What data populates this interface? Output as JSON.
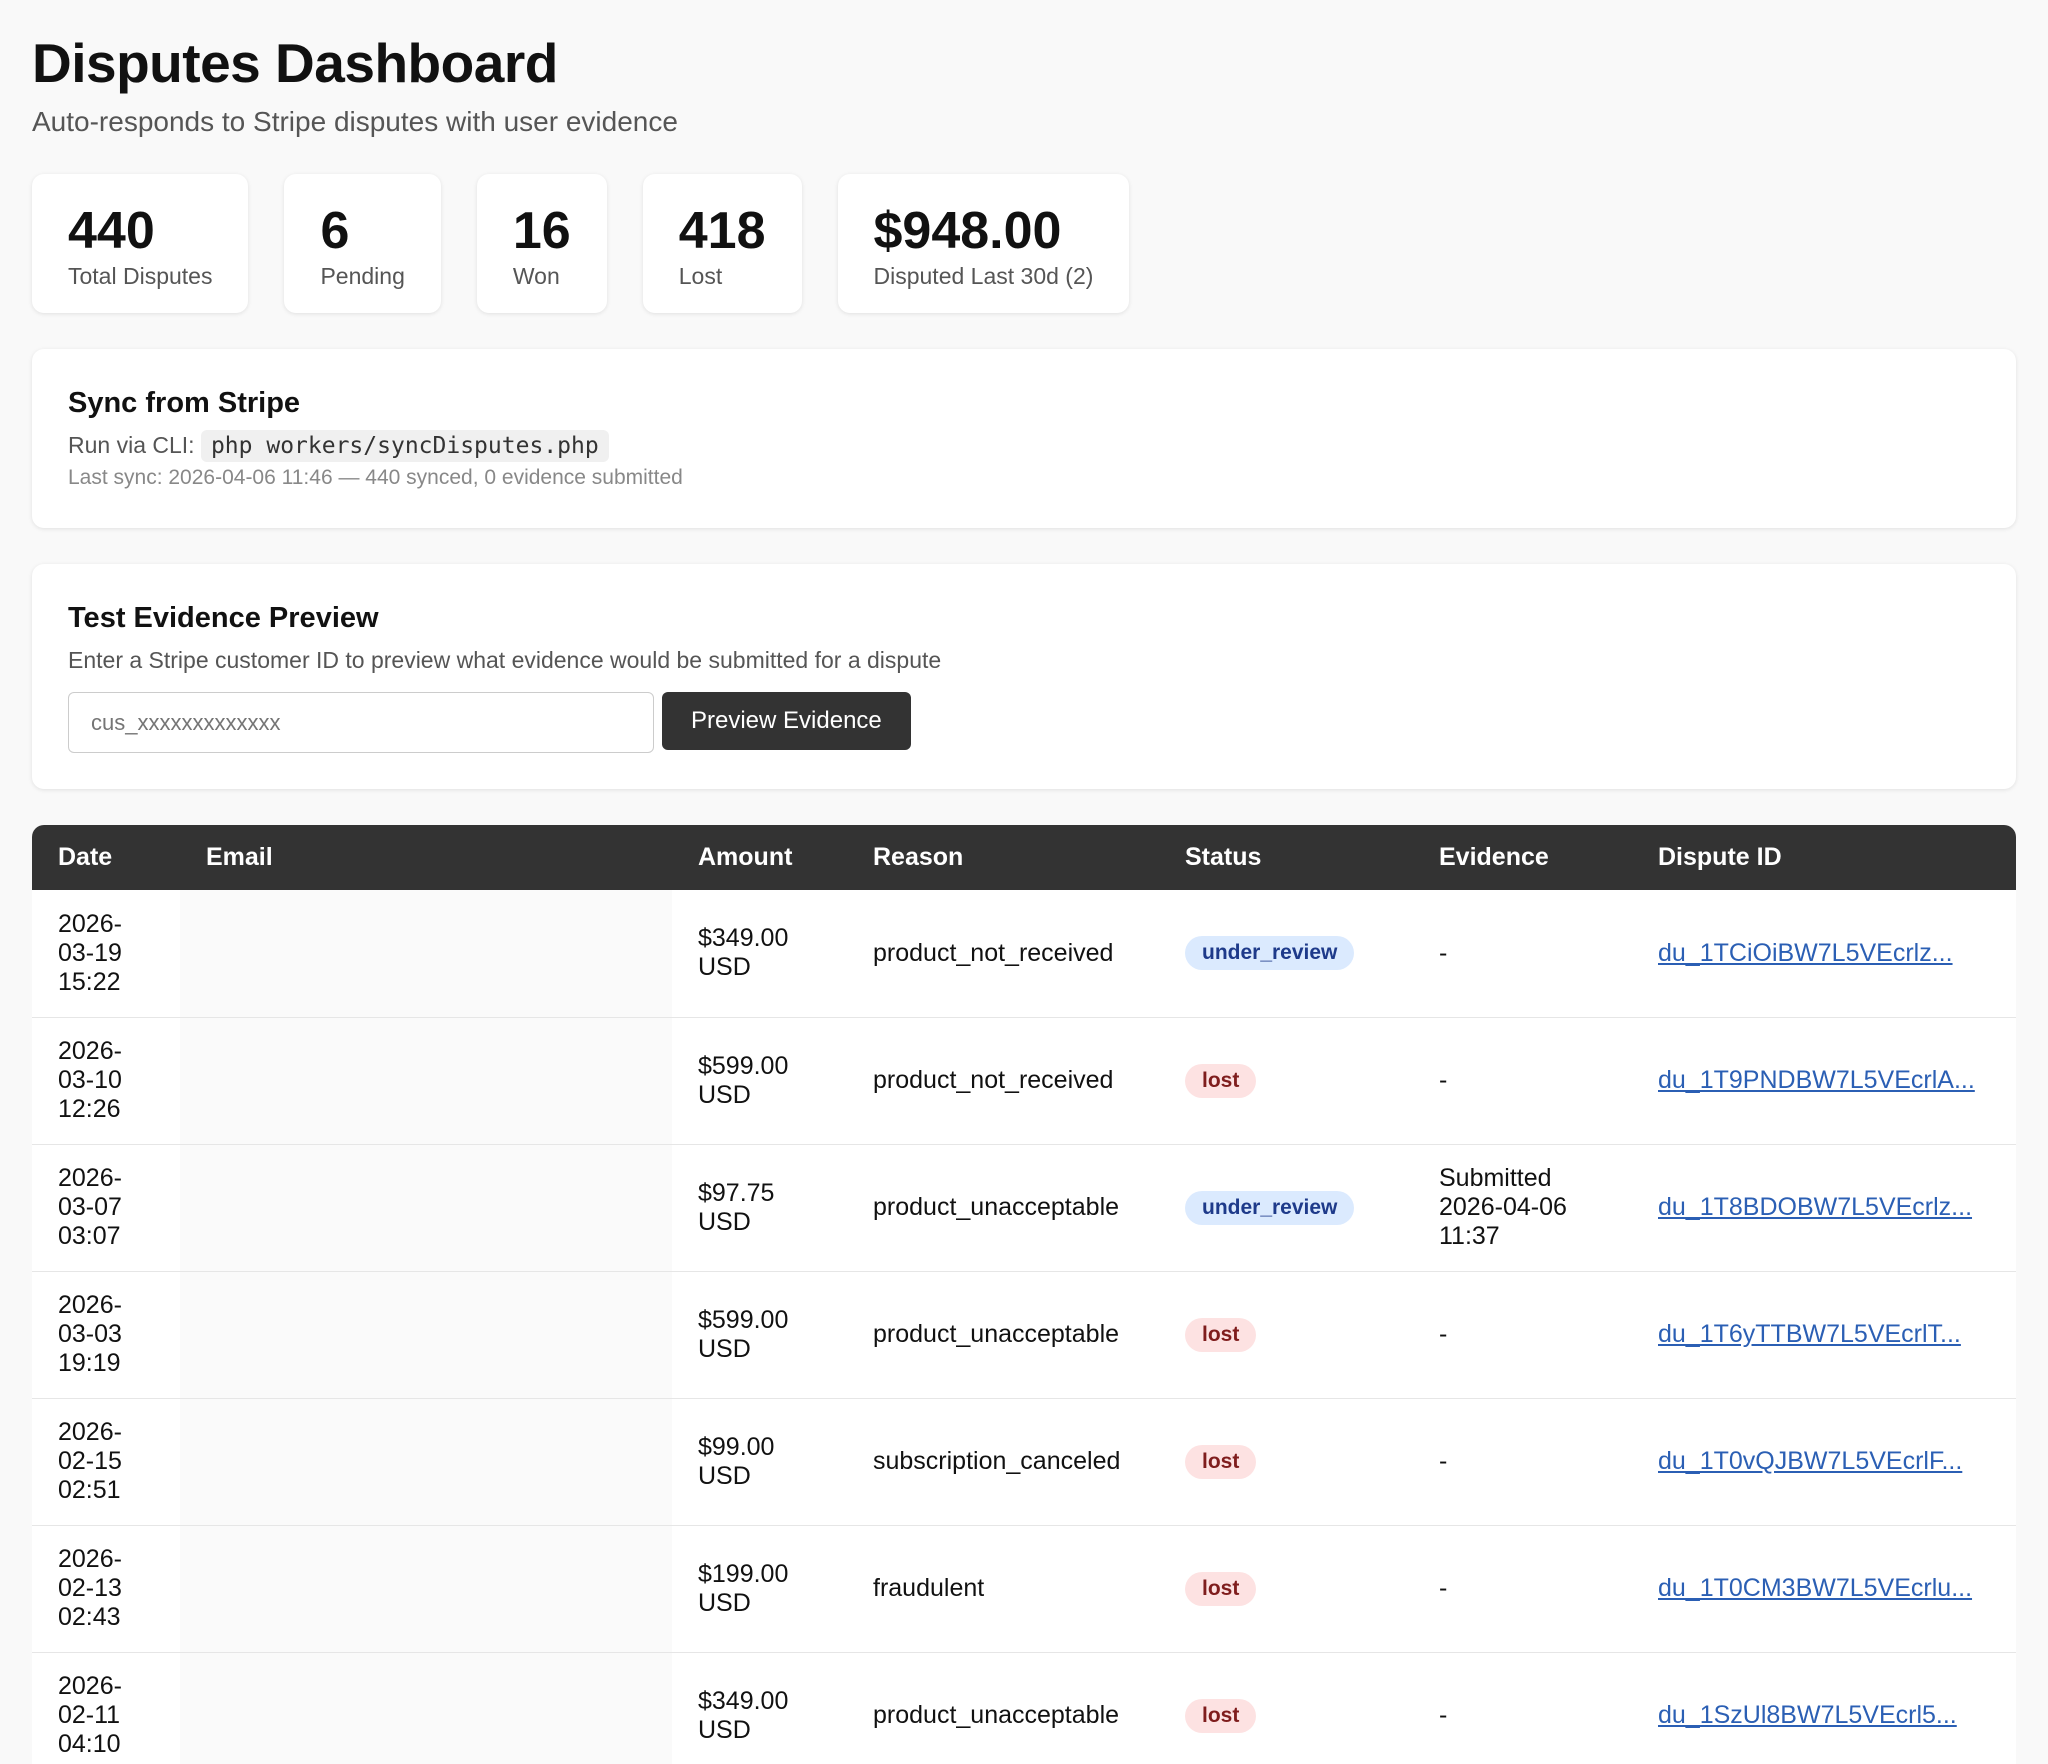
{
  "header": {
    "title": "Disputes Dashboard",
    "subtitle": "Auto-responds to Stripe disputes with user evidence"
  },
  "stats": [
    {
      "value": "440",
      "label": "Total Disputes"
    },
    {
      "value": "6",
      "label": "Pending"
    },
    {
      "value": "16",
      "label": "Won"
    },
    {
      "value": "418",
      "label": "Lost"
    },
    {
      "value": "$948.00",
      "label": "Disputed Last 30d (2)"
    }
  ],
  "sync": {
    "title": "Sync from Stripe",
    "cli_prefix": "Run via CLI:",
    "cli_command": "php workers/syncDisputes.php",
    "last_sync": "Last sync: 2026-04-06 11:46 — 440 synced, 0 evidence submitted"
  },
  "preview": {
    "title": "Test Evidence Preview",
    "description": "Enter a Stripe customer ID to preview what evidence would be submitted for a dispute",
    "input_placeholder": "cus_xxxxxxxxxxxxx",
    "button_label": "Preview Evidence"
  },
  "table": {
    "columns": [
      "Date",
      "Email",
      "Amount",
      "Reason",
      "Status",
      "Evidence",
      "Dispute ID"
    ],
    "rows": [
      {
        "date": [
          "2026-",
          "03-19",
          "15:22"
        ],
        "email": "",
        "amount": [
          "$349.00",
          "USD"
        ],
        "reason": "product_not_received",
        "status": "under_review",
        "evidence": [
          "-"
        ],
        "dispute_id": "du_1TCiOiBW7L5VEcrlz..."
      },
      {
        "date": [
          "2026-",
          "03-10",
          "12:26"
        ],
        "email": "",
        "amount": [
          "$599.00",
          "USD"
        ],
        "reason": "product_not_received",
        "status": "lost",
        "evidence": [
          "-"
        ],
        "dispute_id": "du_1T9PNDBW7L5VEcrlA..."
      },
      {
        "date": [
          "2026-",
          "03-07",
          "03:07"
        ],
        "email": "",
        "amount": [
          "$97.75",
          "USD"
        ],
        "reason": "product_unacceptable",
        "status": "under_review",
        "evidence": [
          "Submitted",
          "2026-04-06",
          "11:37"
        ],
        "dispute_id": "du_1T8BDOBW7L5VEcrlz..."
      },
      {
        "date": [
          "2026-",
          "03-03",
          "19:19"
        ],
        "email": "",
        "amount": [
          "$599.00",
          "USD"
        ],
        "reason": "product_unacceptable",
        "status": "lost",
        "evidence": [
          "-"
        ],
        "dispute_id": "du_1T6yTTBW7L5VEcrlT..."
      },
      {
        "date": [
          "2026-",
          "02-15",
          "02:51"
        ],
        "email": "",
        "amount": [
          "$99.00",
          "USD"
        ],
        "reason": "subscription_canceled",
        "status": "lost",
        "evidence": [
          "-"
        ],
        "dispute_id": "du_1T0vQJBW7L5VEcrlF..."
      },
      {
        "date": [
          "2026-",
          "02-13",
          "02:43"
        ],
        "email": "",
        "amount": [
          "$199.00",
          "USD"
        ],
        "reason": "fraudulent",
        "status": "lost",
        "evidence": [
          "-"
        ],
        "dispute_id": "du_1T0CM3BW7L5VEcrlu..."
      },
      {
        "date": [
          "2026-",
          "02-11",
          "04:10"
        ],
        "email": "",
        "amount": [
          "$349.00",
          "USD"
        ],
        "reason": "product_unacceptable",
        "status": "lost",
        "evidence": [
          "-"
        ],
        "dispute_id": "du_1SzUl8BW7L5VEcrl5..."
      }
    ]
  },
  "colors": {
    "header_bg": "#333333",
    "badge_under_review_bg": "#dbeafe",
    "badge_lost_bg": "#fde2e2",
    "link": "#2b5fb4"
  }
}
